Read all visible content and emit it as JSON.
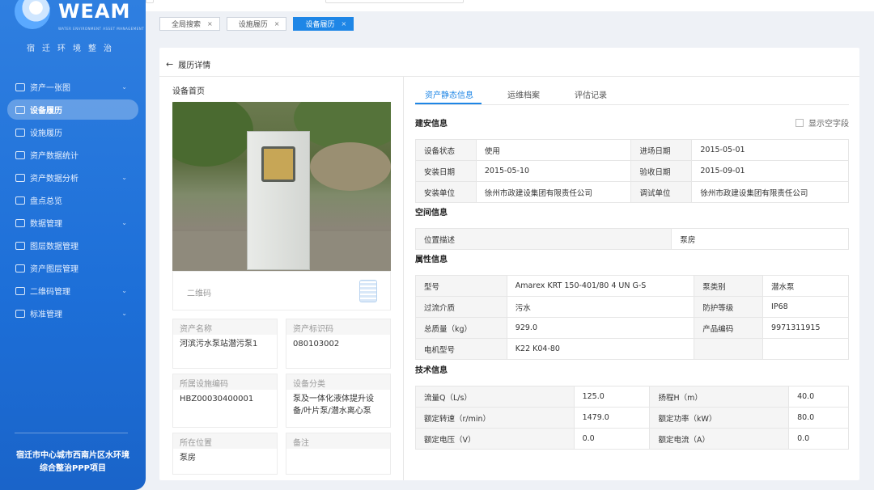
{
  "app": {
    "logo_text": "WEAM",
    "logo_sub": "WATER ENVIRONMENT ASSET MANAGEMENT",
    "slogan": "宿迁环境整治",
    "project": "宿迁市中心城市西南片区水环境综合整治PPP项目"
  },
  "sidebar": {
    "items": [
      {
        "label": "资产一张图",
        "icon": "map-icon",
        "expandable": true
      },
      {
        "label": "设备履历",
        "icon": "device-icon",
        "active": true
      },
      {
        "label": "设施履历",
        "icon": "facility-icon"
      },
      {
        "label": "资产数据统计",
        "icon": "stats-icon"
      },
      {
        "label": "资产数据分析",
        "icon": "analysis-icon",
        "expandable": true
      },
      {
        "label": "盘点总览",
        "icon": "inventory-icon"
      },
      {
        "label": "数据管理",
        "icon": "data-icon",
        "expandable": true
      },
      {
        "label": "图层数据管理",
        "icon": "layer-icon"
      },
      {
        "label": "资产图层管理",
        "icon": "layer-asset-icon"
      },
      {
        "label": "二维码管理",
        "icon": "qrcode-icon",
        "expandable": true
      },
      {
        "label": "标准管理",
        "icon": "standard-icon",
        "expandable": true
      }
    ]
  },
  "tabs": [
    {
      "label": "全局搜索",
      "active": false
    },
    {
      "label": "设施履历",
      "active": false
    },
    {
      "label": "设备履历",
      "active": true
    }
  ],
  "page": {
    "back_label": "履历详情"
  },
  "left": {
    "section_title": "设备首页",
    "qr_label": "二维码",
    "fields": [
      {
        "key": "资产名称",
        "value": "河滨污水泵站潜污泵1"
      },
      {
        "key": "资产标识码",
        "value": "080103002"
      },
      {
        "key": "所属设施编码",
        "value": "HBZ00030400001"
      },
      {
        "key": "设备分类",
        "value": "泵及一体化液体提升设备/叶片泵/潜水离心泵"
      },
      {
        "key": "所在位置",
        "value": "泵房"
      },
      {
        "key": "备注",
        "value": ""
      }
    ]
  },
  "right": {
    "tabs": [
      "资产静态信息",
      "运维档案",
      "评估记录"
    ],
    "show_empty_label": "显示空字段",
    "build": {
      "title": "建安信息",
      "rows": [
        [
          "设备状态",
          "使用",
          "进场日期",
          "2015-05-01"
        ],
        [
          "安装日期",
          "2015-05-10",
          "验收日期",
          "2015-09-01"
        ],
        [
          "安装单位",
          "徐州市政建设集团有限责任公司",
          "调试单位",
          "徐州市政建设集团有限责任公司"
        ]
      ]
    },
    "space": {
      "title": "空间信息",
      "rows": [
        [
          "位置描述",
          "泵房"
        ]
      ]
    },
    "attr": {
      "title": "属性信息",
      "rows": [
        [
          "型号",
          "Amarex KRT 150-401/80 4 UN G-S",
          "泵类别",
          "潜水泵"
        ],
        [
          "过流介质",
          "污水",
          "防护等级",
          "IP68"
        ],
        [
          "总质量（kg）",
          "929.0",
          "产品编码",
          "9971311915"
        ],
        [
          "电机型号",
          "K22 K04-80",
          "",
          ""
        ]
      ]
    },
    "tech": {
      "title": "技术信息",
      "rows": [
        [
          "流量Q（L/s）",
          "125.0",
          "扬程H（m）",
          "40.0"
        ],
        [
          "额定转速（r/min）",
          "1479.0",
          "额定功率（kW）",
          "80.0"
        ],
        [
          "额定电压（V）",
          "0.0",
          "额定电流（A）",
          "0.0"
        ]
      ]
    }
  }
}
